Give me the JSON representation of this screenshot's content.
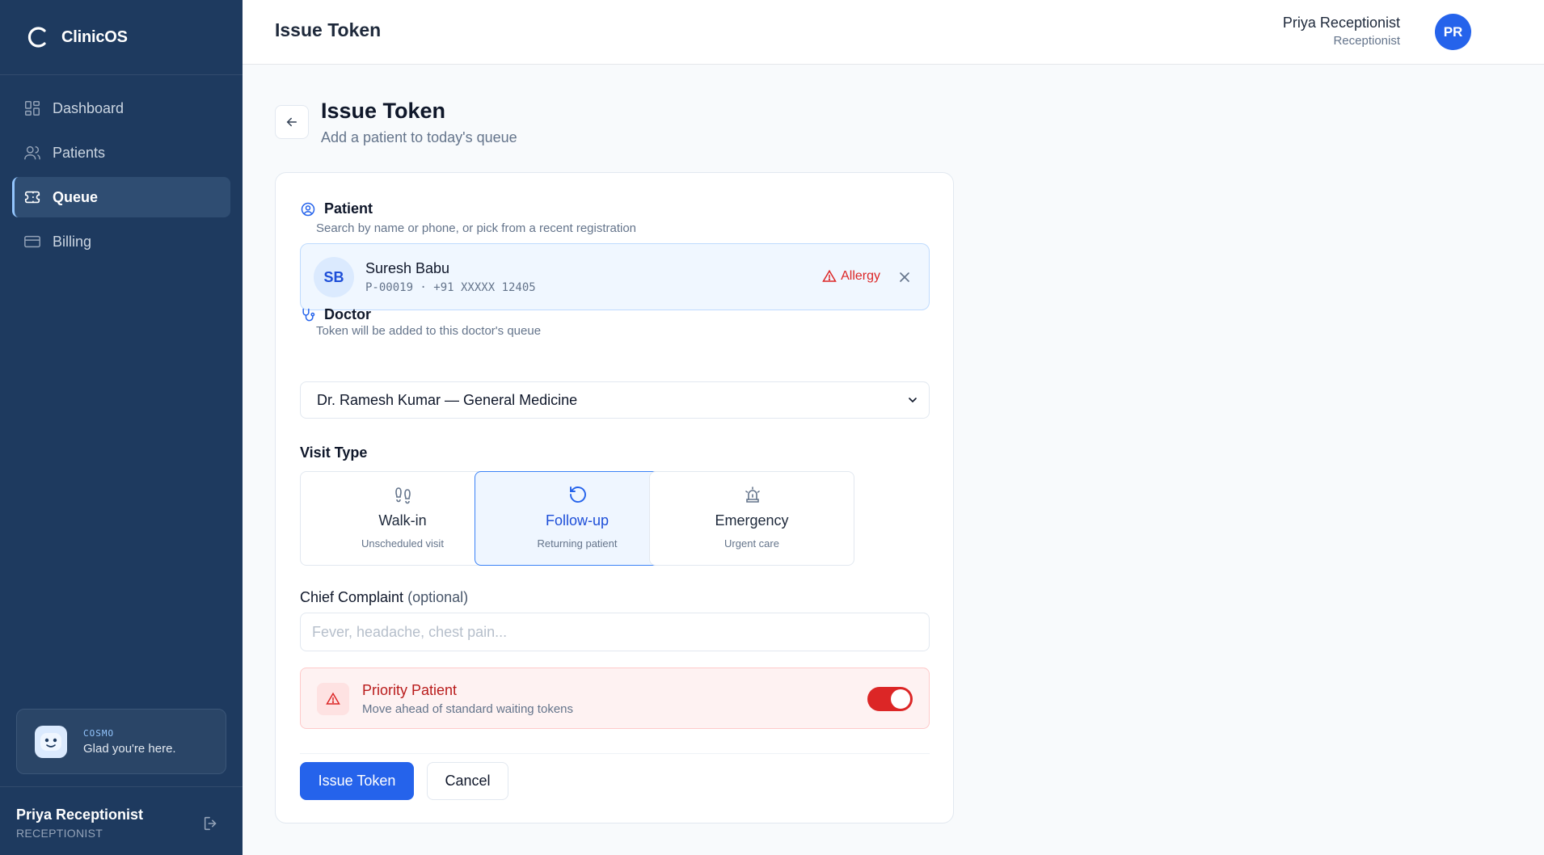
{
  "app": {
    "name": "ClinicOS"
  },
  "sidebar": {
    "items": [
      {
        "label": "Dashboard",
        "icon": "dashboard-icon",
        "active": false
      },
      {
        "label": "Patients",
        "icon": "users-icon",
        "active": false
      },
      {
        "label": "Queue",
        "icon": "ticket-icon",
        "active": true
      },
      {
        "label": "Billing",
        "icon": "credit-card-icon",
        "active": false
      }
    ],
    "assistant": {
      "name": "COSMO",
      "message": "Glad you're here."
    },
    "footer": {
      "user_name": "Priya Receptionist",
      "user_role": "RECEPTIONIST"
    }
  },
  "topbar": {
    "title": "Issue Token",
    "user_name": "Priya Receptionist",
    "user_role": "Receptionist",
    "avatar_initials": "PR"
  },
  "page": {
    "title": "Issue Token",
    "subtitle": "Add a patient to today's queue"
  },
  "form": {
    "patient": {
      "title": "Patient",
      "description": "Search by name or phone, or pick from a recent registration",
      "selected": {
        "initials": "SB",
        "name": "Suresh Babu",
        "meta": "P-00019 · +91 XXXXX 12405",
        "alert": "Allergy"
      }
    },
    "doctor": {
      "title": "Doctor",
      "description": "Token will be added to this doctor's queue",
      "selected": "Dr. Ramesh Kumar — General Medicine"
    },
    "visit_type": {
      "label": "Visit Type",
      "options": [
        {
          "name": "Walk-in",
          "desc": "Unscheduled visit",
          "icon": "footsteps-icon",
          "selected": false
        },
        {
          "name": "Follow-up",
          "desc": "Returning patient",
          "icon": "rotate-ccw-icon",
          "selected": true
        },
        {
          "name": "Emergency",
          "desc": "Urgent care",
          "icon": "siren-icon",
          "selected": false
        }
      ]
    },
    "chief_complaint": {
      "label": "Chief Complaint",
      "optional": "(optional)",
      "value": "",
      "placeholder": "Fever, headache, chest pain..."
    },
    "priority": {
      "title": "Priority Patient",
      "description": "Move ahead of standard waiting tokens",
      "enabled": true
    },
    "actions": {
      "submit": "Issue Token",
      "cancel": "Cancel"
    }
  },
  "colors": {
    "sidebar_bg": "#1e3a5f",
    "primary": "#2563eb",
    "danger": "#dc2626"
  }
}
